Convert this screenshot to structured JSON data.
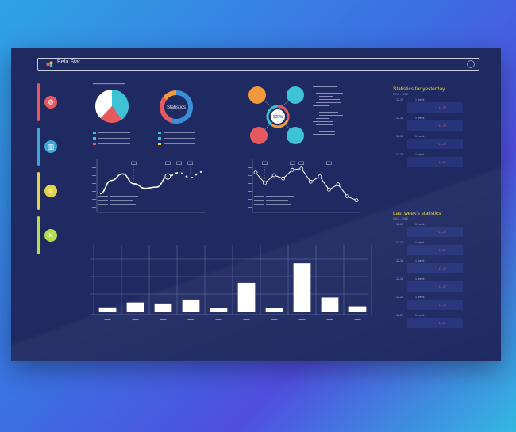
{
  "app": {
    "title": "Beta Stat"
  },
  "colors": {
    "panel": "#1f2a63",
    "red": "#e65a5f",
    "cyan": "#3ec3d6",
    "yellow": "#e6d24a",
    "green": "#b6dd4b",
    "orange": "#f29a3b",
    "blue": "#3a8fd6",
    "text": "#dfe3f2"
  },
  "sidebar": {
    "items": [
      {
        "name": "sidebar-item-1",
        "icon": "gear-icon",
        "color": "#e65a5f",
        "glyph": "⚙"
      },
      {
        "name": "sidebar-item-2",
        "icon": "bar-chart-icon",
        "color": "#3ea6d6",
        "glyph": "▥"
      },
      {
        "name": "sidebar-item-3",
        "icon": "chat-icon",
        "color": "#e6d24a",
        "glyph": "≡"
      },
      {
        "name": "sidebar-item-4",
        "icon": "close-icon",
        "color": "#b6dd4b",
        "glyph": "✕"
      }
    ]
  },
  "donut": {
    "center_label": "Statistics"
  },
  "hub": {
    "center_label": "100%"
  },
  "yesterday": {
    "title": "Statistics for yesterday",
    "range": "2017 - 2018",
    "rows": [
      {
        "date": "12.12",
        "label": "1 week",
        "value": "+ 11.22"
      },
      {
        "date": "12.14",
        "label": "1 week",
        "value": "+ 11.22"
      },
      {
        "date": "12.16",
        "label": "1 week",
        "value": "+ 11.22"
      },
      {
        "date": "12.18",
        "label": "1 week",
        "value": "+ 11.22"
      }
    ]
  },
  "lastweek": {
    "title": "Last week's statistics",
    "range": "2017 - 2018",
    "rows": [
      {
        "date": "12.12",
        "label": "1 week",
        "value": "+ 11.22"
      },
      {
        "date": "12.14",
        "label": "1 week",
        "value": "+ 11.22"
      },
      {
        "date": "12.16",
        "label": "1 week",
        "value": "+ 11.22"
      },
      {
        "date": "12.18",
        "label": "1 week",
        "value": "+ 11.22"
      },
      {
        "date": "12.20",
        "label": "1 week",
        "value": "+ 11.22"
      },
      {
        "date": "12.22",
        "label": "1 week",
        "value": "+ 11.22"
      }
    ]
  },
  "chart_data": [
    {
      "type": "pie",
      "values": [
        40,
        22,
        38
      ],
      "colors": [
        "#3ec3d6",
        "#e65a5f",
        "#ffffff"
      ]
    },
    {
      "type": "pie",
      "values": [
        55,
        30,
        15
      ],
      "colors": [
        "#3a8fd6",
        "#e65a5f",
        "#f29a3b"
      ]
    },
    {
      "type": "line",
      "x": [
        1,
        2,
        3,
        4,
        5,
        6,
        7,
        8,
        9,
        10
      ],
      "values": [
        2,
        4,
        5,
        3.5,
        2.8,
        3,
        4.6,
        5.2,
        4.4,
        5.3
      ]
    },
    {
      "type": "line",
      "x": [
        1,
        2,
        3,
        4,
        5,
        6,
        7,
        8,
        9,
        10,
        11,
        12
      ],
      "values": [
        5.2,
        3.6,
        4.8,
        4.3,
        5.6,
        5.8,
        3.8,
        4.6,
        2.6,
        3.4,
        1.6,
        1.0
      ]
    },
    {
      "type": "bar",
      "categories": [
        "",
        "",
        "",
        "",
        "",
        "",
        "",
        "",
        "",
        ""
      ],
      "values": [
        5,
        10,
        9,
        13,
        4,
        30,
        4,
        50,
        15,
        6
      ],
      "ylim": [
        0,
        55
      ]
    }
  ]
}
